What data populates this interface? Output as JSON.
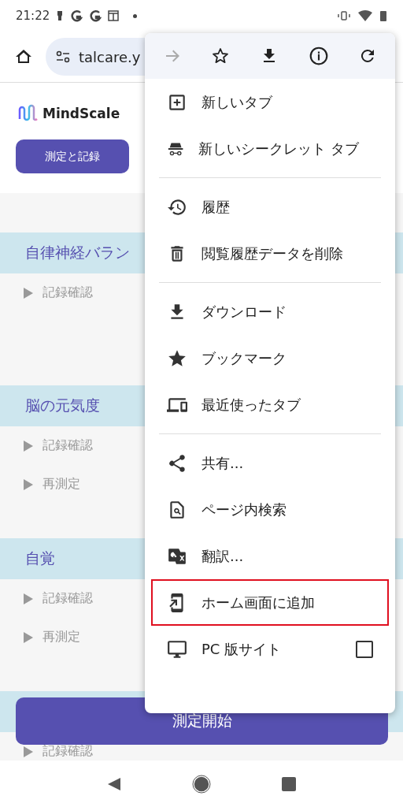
{
  "status_bar": {
    "time": "21:22"
  },
  "address_bar": {
    "url": "talcare.y"
  },
  "header": {
    "logo": "MindScale",
    "button": "測定と記録"
  },
  "sections": [
    {
      "title": "自律神経バラン",
      "links": [
        "記録確認"
      ]
    },
    {
      "title": "脳の元気度",
      "links": [
        "記録確認",
        "再測定"
      ]
    },
    {
      "title": "自覚",
      "links": [
        "記録確認",
        "再測定"
      ]
    },
    {
      "links": [
        "記録確認"
      ]
    }
  ],
  "start_button": "測定開始",
  "menu": {
    "groups": [
      [
        {
          "kind": "item",
          "label": "新しいタブ",
          "highlighted": false
        },
        {
          "kind": "item",
          "label": "新しいシークレット タブ",
          "highlighted": false
        }
      ],
      [
        {
          "kind": "item",
          "label": "履歴",
          "highlighted": false
        },
        {
          "kind": "item",
          "label": "閲覧履歴データを削除",
          "highlighted": false
        }
      ],
      [
        {
          "kind": "item",
          "label": "ダウンロード",
          "highlighted": false
        },
        {
          "kind": "item",
          "label": "ブックマーク",
          "highlighted": false
        },
        {
          "kind": "item",
          "label": "最近使ったタブ",
          "highlighted": false
        }
      ],
      [
        {
          "kind": "item",
          "label": "共有...",
          "highlighted": false
        },
        {
          "kind": "item",
          "label": "ページ内検索",
          "highlighted": false
        },
        {
          "kind": "item",
          "label": "翻訳...",
          "highlighted": false
        },
        {
          "kind": "item",
          "label": "ホーム画面に追加",
          "highlighted": true
        },
        {
          "kind": "checkbox",
          "label": "PC 版サイト",
          "checked": false,
          "highlighted": false
        }
      ]
    ]
  }
}
